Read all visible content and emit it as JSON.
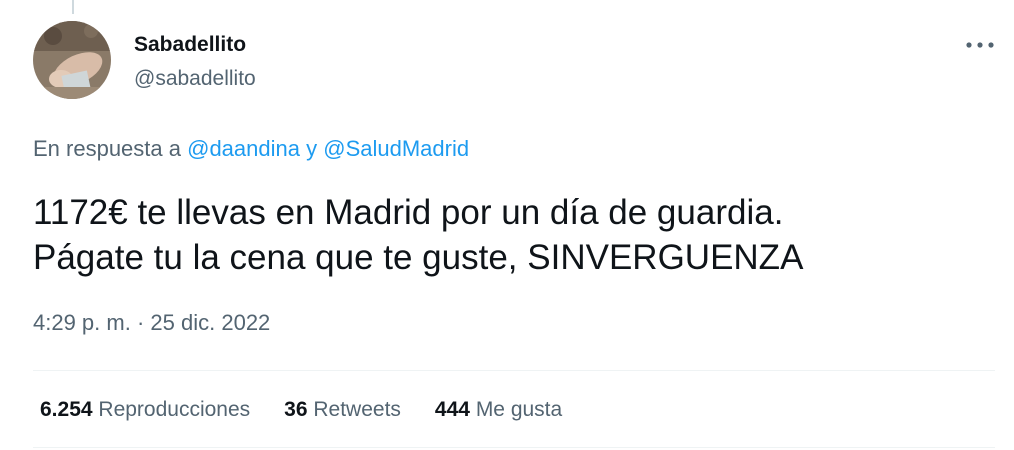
{
  "author": {
    "name": "Sabadellito",
    "handle": "@sabadellito"
  },
  "icons": {
    "more": "more-options-icon"
  },
  "reply": {
    "prefix": "En respuesta a",
    "mention1": "@daandina",
    "connector": "y",
    "mention2": "@SaludMadrid"
  },
  "tweet": {
    "lines": [
      "1172€ te llevas en Madrid por un día de guardia.",
      "Págate tu la cena que te guste, SINVERGUENZA"
    ]
  },
  "meta": {
    "time": "4:29 p. m.",
    "separator": "·",
    "date": "25 dic. 2022"
  },
  "stats": {
    "views": {
      "count": "6.254",
      "label": "Reproducciones"
    },
    "retweets": {
      "count": "36",
      "label": "Retweets"
    },
    "likes": {
      "count": "444",
      "label": "Me gusta"
    }
  },
  "colors": {
    "text": "#0f1419",
    "secondary": "#536471",
    "link": "#1d9bf0",
    "divider": "#eff3f4"
  }
}
